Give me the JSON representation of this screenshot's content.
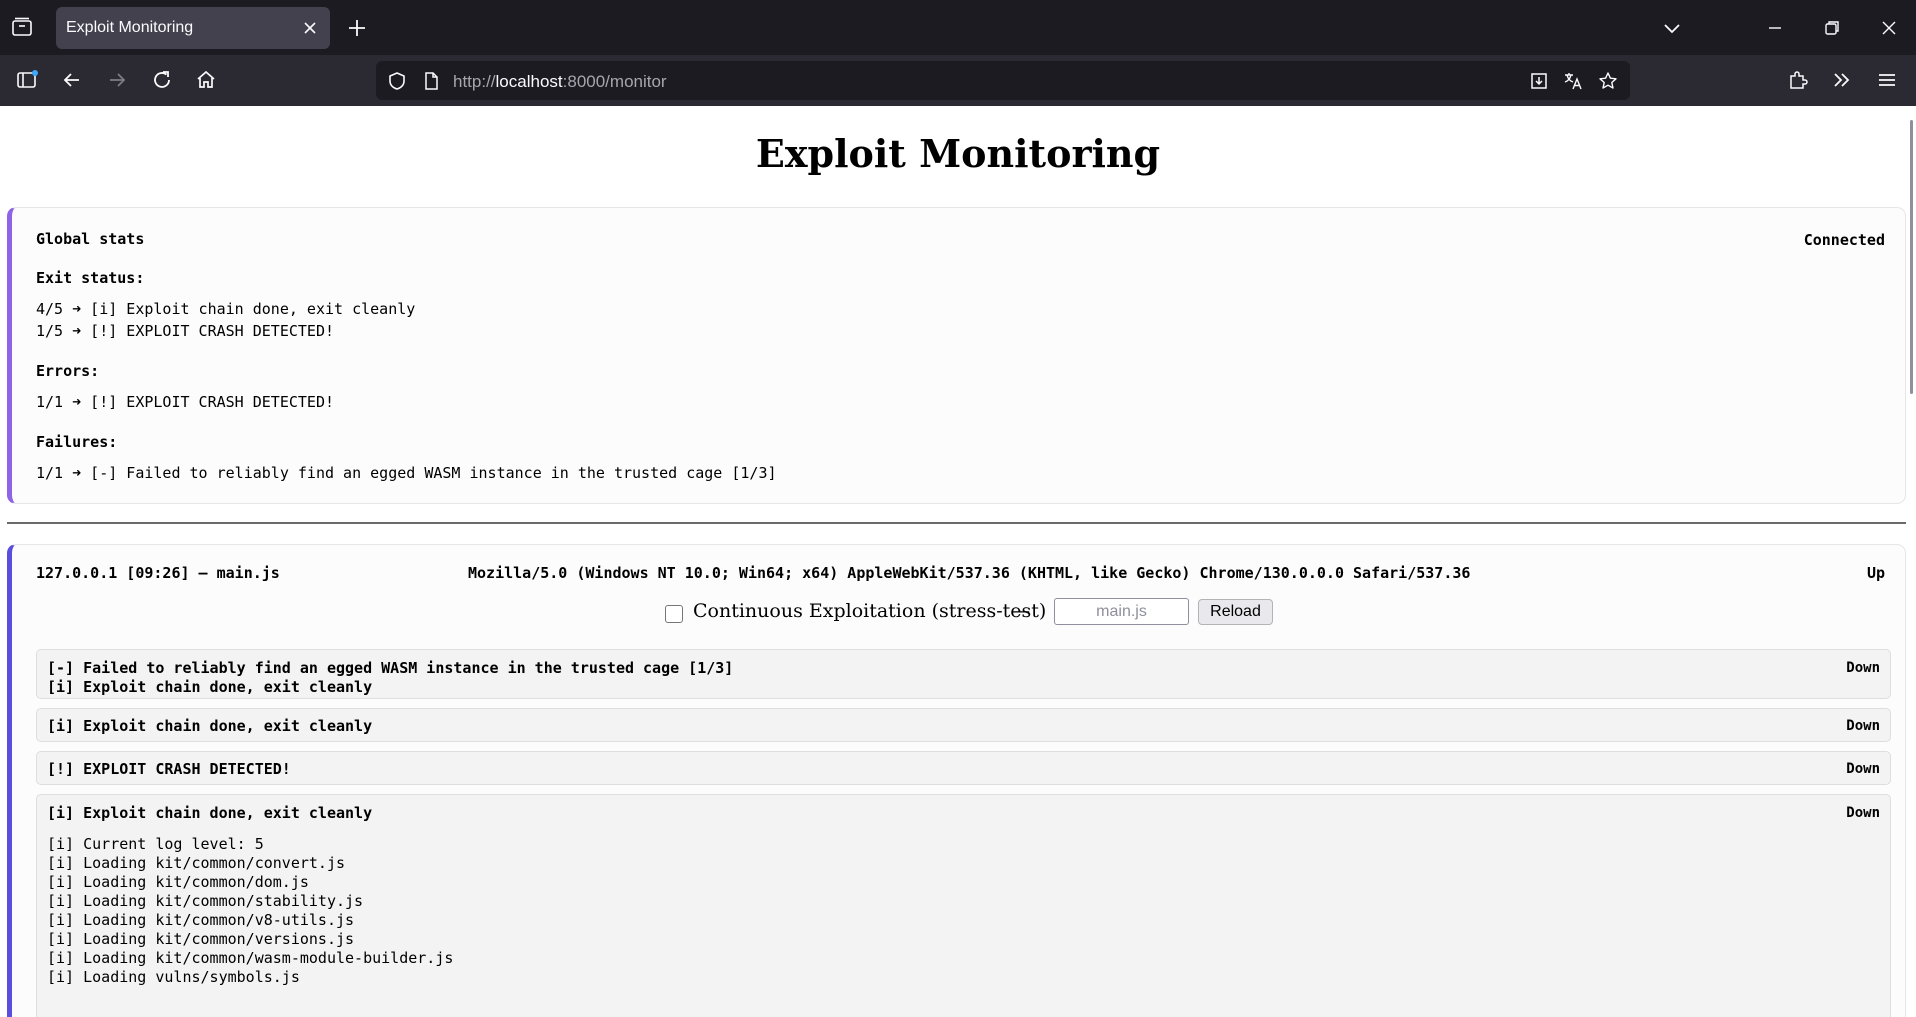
{
  "browser": {
    "tab_title": "Exploit Monitoring",
    "url_scheme": "http://",
    "url_host": "localhost",
    "url_rest": ":8000/monitor"
  },
  "page": {
    "title": "Exploit Monitoring"
  },
  "global_stats": {
    "heading": "Global stats",
    "connection": "Connected",
    "exit_status_heading": "Exit status:",
    "exit_status": [
      "4/5 ➜ [i] Exploit chain done, exit cleanly",
      "1/5 ➜ [!] EXPLOIT CRASH DETECTED!"
    ],
    "errors_heading": "Errors:",
    "errors": [
      "1/1 ➜ [!] EXPLOIT CRASH DETECTED!"
    ],
    "failures_heading": "Failures:",
    "failures": [
      "1/1 ➜ [-] Failed to reliably find an egged WASM instance in the trusted cage [1/3]"
    ]
  },
  "session": {
    "header": "127.0.0.1 [09:26] — main.js",
    "user_agent": "Mozilla/5.0 (Windows NT 10.0; Win64; x64) AppleWebKit/537.36 (KHTML, like Gecko) Chrome/130.0.0.0 Safari/537.36",
    "status": "Up",
    "continuous_label": "Continuous Exploitation (stress-test)",
    "separator": "—",
    "script_placeholder": "main.js",
    "reload_label": "Reload",
    "runs": [
      {
        "lines": [
          "[-] Failed to reliably find an egged WASM instance in the trusted cage [1/3]",
          "[i] Exploit chain done, exit cleanly"
        ],
        "status": "Down"
      },
      {
        "lines": [
          "[i] Exploit chain done, exit cleanly"
        ],
        "status": "Down"
      },
      {
        "lines": [
          "[!] EXPLOIT CRASH DETECTED!"
        ],
        "status": "Down"
      },
      {
        "lines": [
          "[i] Exploit chain done, exit cleanly"
        ],
        "status": "Down",
        "log": [
          "[i] Current log level: 5",
          "[i] Loading kit/common/convert.js",
          "[i] Loading kit/common/dom.js",
          "[i] Loading kit/common/stability.js",
          "[i] Loading kit/common/v8-utils.js",
          "[i] Loading kit/common/versions.js",
          "[i] Loading kit/common/wasm-module-builder.js",
          "[i] Loading vulns/symbols.js"
        ]
      }
    ]
  }
}
